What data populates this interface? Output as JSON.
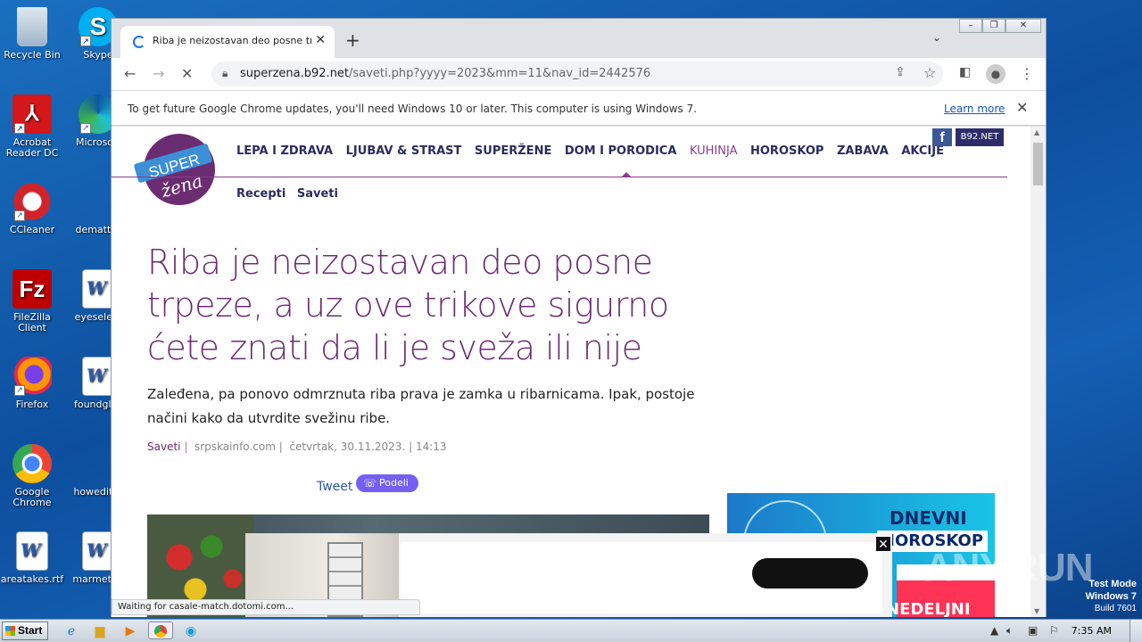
{
  "desktop": {
    "icons": [
      {
        "label": "Recycle Bin"
      },
      {
        "label": "Skype"
      },
      {
        "label": "Acrobat Reader DC"
      },
      {
        "label": "Microsoft"
      },
      {
        "label": "CCleaner"
      },
      {
        "label": "dematter"
      },
      {
        "label": "FileZilla Client"
      },
      {
        "label": "eyeselect"
      },
      {
        "label": "Firefox"
      },
      {
        "label": "foundglas"
      },
      {
        "label": "Google Chrome"
      },
      {
        "label": "howeditor"
      },
      {
        "label": "areatakes.rtf"
      },
      {
        "label": "marmetho"
      }
    ]
  },
  "browser": {
    "tab_title": "Riba je neizostavan deo posne trpeze",
    "url_host": "superzena.b92.net",
    "url_path": "/saveti.php?yyyy=2023&mm=11&nav_id=2442576",
    "infobar_text": "To get future Google Chrome updates, you'll need Windows 10 or later. This computer is using Windows 7.",
    "infobar_link": "Learn more",
    "status_text": "Waiting for casale-match.dotomi.com..."
  },
  "site": {
    "logo_top": "SUPER",
    "logo_bottom": "žena",
    "nav": [
      "LEPA I ZDRAVA",
      "LJUBAV & STRAST",
      "SUPERŽENE",
      "DOM I PORODICA",
      "KUHINJA",
      "HOROSKOP",
      "ZABAVA",
      "AKCIJE"
    ],
    "nav_active": "KUHINJA",
    "subnav": [
      "Recepti",
      "Saveti"
    ],
    "fb_label": "f",
    "b92_label": "B92.NET"
  },
  "article": {
    "headline": "Riba je neizostavan deo posne trpeze, a uz ove trikove sigurno ćete znati da li je sveža ili nije",
    "lead": "Zaleđena, pa ponovo odmrznuta riba prava je zamka u ribarnicama. Ipak, postoje načini kako da utvrdite svežinu ribe.",
    "category": "Saveti",
    "source": "srpskainfo.com",
    "date": "četvrtak, 30.11.2023. | 14:13",
    "tweet_label": "Tweet",
    "share_label": "Podeli"
  },
  "ad_horoscope": {
    "line1": "DNEVNI",
    "line2": "HOROSKOP",
    "line3": "NEDELJNI"
  },
  "overlay": {
    "watermark": "ANY.RUN",
    "test_mode": "Test Mode",
    "os": "Windows 7",
    "build": "Build 7601"
  },
  "taskbar": {
    "start_label": "Start",
    "clock": "7:35 AM"
  }
}
